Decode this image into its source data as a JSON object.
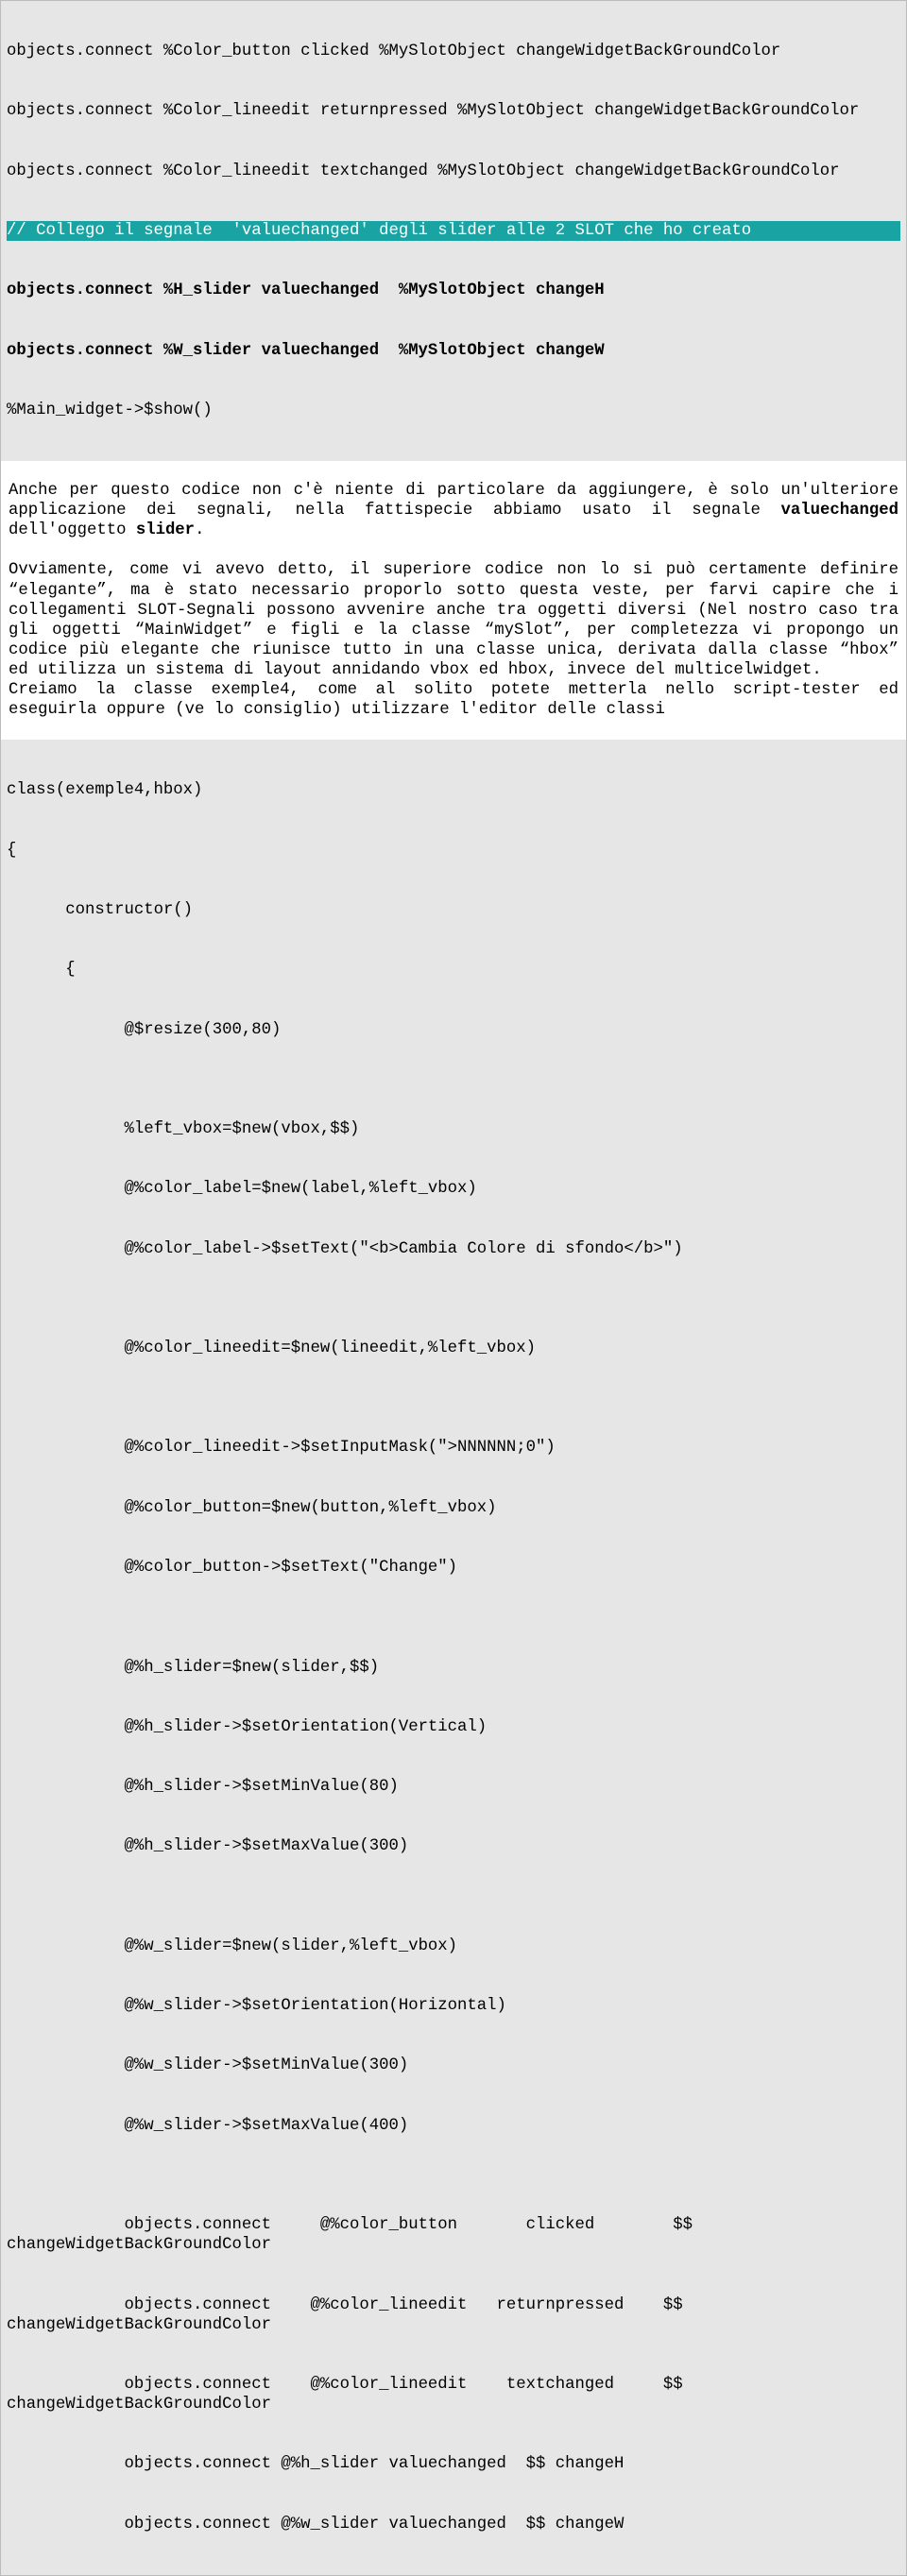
{
  "top_code": {
    "l1": "objects.connect %Color_button clicked %MySlotObject changeWidgetBackGroundColor",
    "l2": "objects.connect %Color_lineedit returnpressed %MySlotObject changeWidgetBackGroundColor",
    "l3": "objects.connect %Color_lineedit textchanged %MySlotObject changeWidgetBackGroundColor",
    "l4": "// Collego il segnale  'valuechanged' degli slider alle 2 SLOT che ho creato ",
    "l5": "objects.connect %H_slider valuechanged  %MySlotObject changeH",
    "l6": "objects.connect %W_slider valuechanged  %MySlotObject changeW",
    "l7": "%Main_widget->$show()"
  },
  "prose": {
    "p1a": "Anche per questo codice non c'è niente di particolare da aggiungere, è solo un'ulteriore applicazione dei segnali, nella fattispecie abbiamo usato il segnale ",
    "p1b": "valuechanged",
    "p1c": " dell'oggetto ",
    "p1d": "slider",
    "p1e": ".",
    "p2": "Ovviamente, come vi avevo detto, il superiore codice non lo si può certamente definire “elegante”, ma è stato necessario proporlo sotto questa veste, per farvi capire che i collegamenti SLOT-Segnali possono avvenire anche tra oggetti diversi (Nel nostro caso tra gli oggetti “MainWidget” e figli e la classe “mySlot”, per completezza vi propongo un codice più elegante che riunisce tutto in una classe unica, derivata dalla classe “hbox” ed utilizza un sistema di layout annidando vbox ed hbox, invece del multicelwidget.",
    "p3": "Creiamo la classe exemple4, come al solito potete metterla nello script-tester ed eseguirla oppure (ve lo consiglio) utilizzare l'editor delle classi"
  },
  "bottom_code": {
    "c1": "class(exemple4,hbox)",
    "c2": "{",
    "c3": "      constructor()",
    "c4": "      {",
    "c5": "            @$resize(300,80)",
    "c6": "",
    "c7": "            %left_vbox=$new(vbox,$$)",
    "c8": "            @%color_label=$new(label,%left_vbox)",
    "c9": "            @%color_label->$setText(\"<b>Cambia Colore di sfondo</b>\")",
    "c10": "",
    "c11": "            @%color_lineedit=$new(lineedit,%left_vbox)",
    "c12": "",
    "c13": "            @%color_lineedit->$setInputMask(\">NNNNNN;0\")",
    "c14": "            @%color_button=$new(button,%left_vbox)",
    "c15": "            @%color_button->$setText(\"Change\")",
    "c16": "",
    "c17": "            @%h_slider=$new(slider,$$)",
    "c18": "            @%h_slider->$setOrientation(Vertical)",
    "c19": "            @%h_slider->$setMinValue(80)",
    "c20": "            @%h_slider->$setMaxValue(300)",
    "c21": "",
    "c22": "            @%w_slider=$new(slider,%left_vbox)",
    "c23": "            @%w_slider->$setOrientation(Horizontal)",
    "c24": "            @%w_slider->$setMinValue(300)",
    "c25": "            @%w_slider->$setMaxValue(400)",
    "c26": "",
    "c27": "            objects.connect     @%color_button       clicked        $$ changeWidgetBackGroundColor",
    "c28": "            objects.connect    @%color_lineedit   returnpressed    $$ changeWidgetBackGroundColor",
    "c29": "            objects.connect    @%color_lineedit    textchanged     $$ changeWidgetBackGroundColor",
    "c30": "            objects.connect @%h_slider valuechanged  $$ changeH",
    "c31": "            objects.connect @%w_slider valuechanged  $$ changeW"
  }
}
